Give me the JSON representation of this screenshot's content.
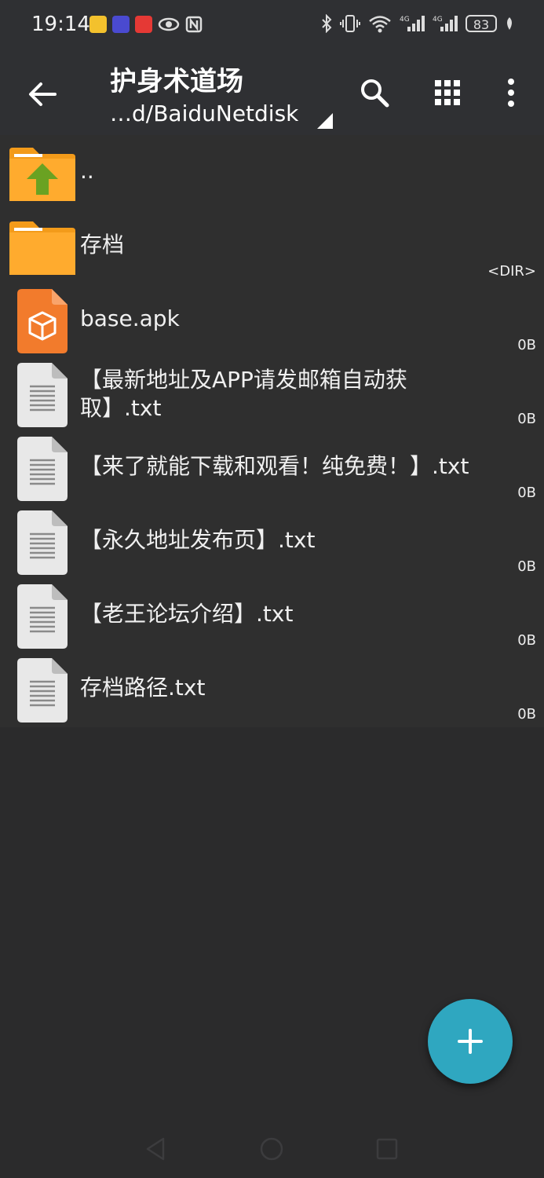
{
  "status_bar": {
    "time": "19:14",
    "battery": "83",
    "notification_icons": [
      "weibo-icon",
      "app-badge-icon",
      "red-app-icon",
      "eye-icon",
      "nfc-icon"
    ],
    "system_icons": [
      "bluetooth-icon",
      "vibrate-icon",
      "wifi-icon",
      "signal-4g-icon",
      "signal-4g-icon",
      "battery-icon",
      "leaf-icon"
    ]
  },
  "app_bar": {
    "title": "护身术道场",
    "path": "…d/BaiduNetdisk",
    "icons": [
      "back-arrow-icon",
      "search-icon",
      "grid-view-icon",
      "more-vert-icon"
    ]
  },
  "files": [
    {
      "name": "..",
      "size": "",
      "icon": "folder-up-icon"
    },
    {
      "name": "存档",
      "size": "<DIR>",
      "icon": "folder-icon"
    },
    {
      "name": "base.apk",
      "size": "0B",
      "icon": "apk-icon"
    },
    {
      "name_line1": "【最新地址及APP请发邮箱自动获",
      "name_line2": "取】.txt",
      "size": "0B",
      "icon": "text-file-icon"
    },
    {
      "name": "【来了就能下载和观看！纯免费！】.txt",
      "size": "0B",
      "icon": "text-file-icon"
    },
    {
      "name": "【永久地址发布页】.txt",
      "size": "0B",
      "icon": "text-file-icon"
    },
    {
      "name": "【老王论坛介绍】.txt",
      "size": "0B",
      "icon": "text-file-icon"
    },
    {
      "name": "存档路径.txt",
      "size": "0B",
      "icon": "text-file-icon"
    }
  ],
  "fab": {
    "icon": "plus-icon"
  },
  "nav_bar": {
    "icons": [
      "nav-back-icon",
      "nav-home-icon",
      "nav-recents-icon"
    ]
  },
  "colors": {
    "background": "#2b2b2c",
    "folder": "#ffab2e",
    "folder_up_arrow": "#6aa222",
    "apk": "#f27b2c",
    "fab": "#2fa7c0"
  }
}
